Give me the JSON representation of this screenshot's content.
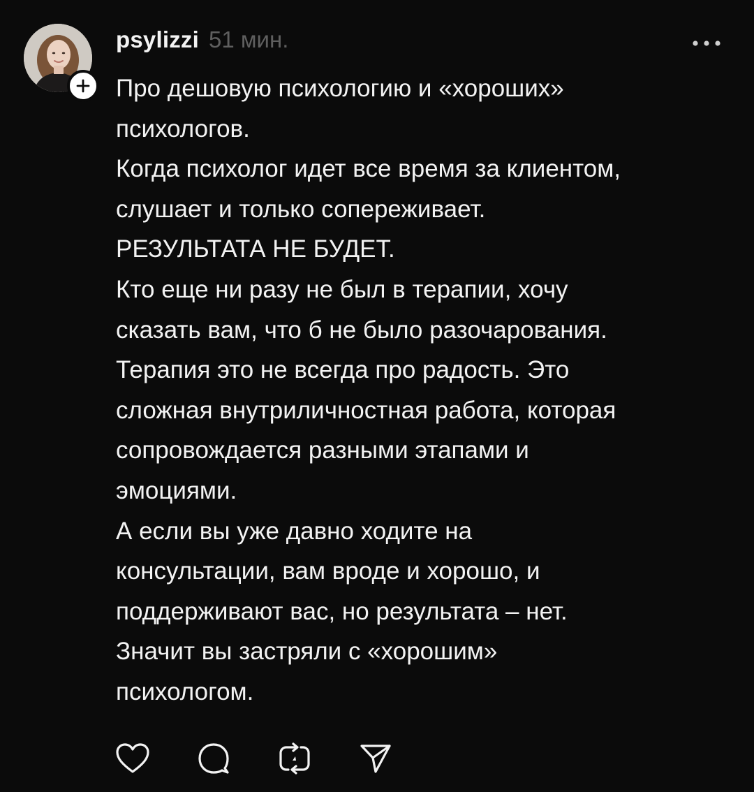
{
  "post": {
    "username": "psylizzi",
    "timestamp": "51 мин.",
    "text_lines": [
      "Про дешовую психологию и «хороших»",
      "психологов.",
      "Когда психолог идет все время  за клиентом,",
      "слушает и только сопереживает.",
      "РЕЗУЛЬТАТА НЕ БУДЕТ.",
      "Кто еще ни разу не был в терапии, хочу",
      "сказать вам, что б не было разочарования.",
      "Терапия это не всегда про радость. Это",
      "сложная внутриличностная работа, которая",
      "сопровождается разными этапами и",
      "эмоциями.",
      "А если вы уже давно ходите на",
      "консультации, вам вроде и хорошо, и",
      "поддерживают вас, но результата – нет.",
      "Значит вы застряли с «хорошим»",
      "психологом."
    ]
  },
  "icons": {
    "avatar": "avatar-photo",
    "follow": "plus-icon",
    "more": "more-horizontal-icon",
    "like": "heart-icon",
    "comment": "comment-icon",
    "repost": "repost-icon",
    "share": "send-icon"
  },
  "colors": {
    "background": "#0b0b0b",
    "text": "#f3f3f3",
    "muted": "#5f5f5f"
  }
}
